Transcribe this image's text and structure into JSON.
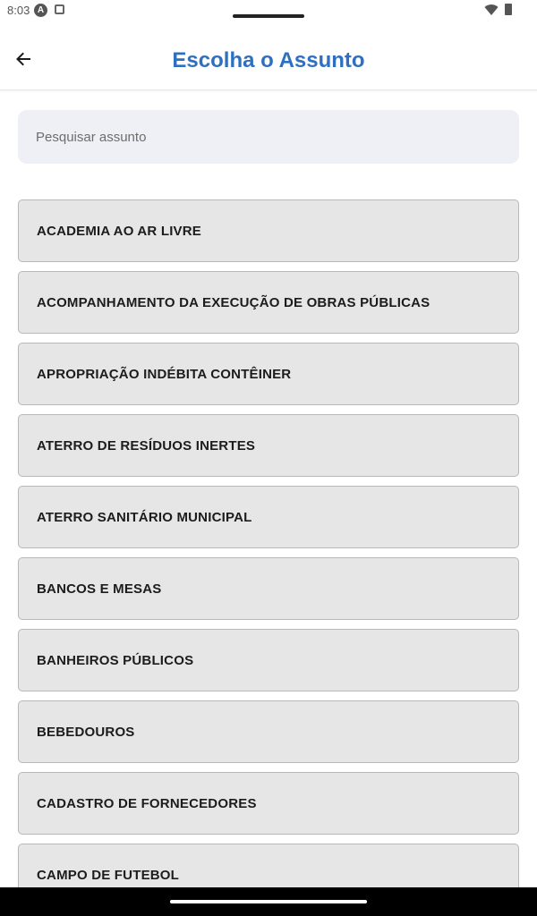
{
  "status_bar": {
    "time": "8:03",
    "app_icon_letter": "A"
  },
  "header": {
    "title": "Escolha o Assunto",
    "title_color": "#2f6fc0"
  },
  "search": {
    "placeholder": "Pesquisar assunto",
    "value": ""
  },
  "subjects": [
    {
      "label": "ACADEMIA AO AR LIVRE"
    },
    {
      "label": "ACOMPANHAMENTO DA EXECUÇÃO DE OBRAS PÚBLICAS"
    },
    {
      "label": "APROPRIAÇÃO INDÉBITA CONTÊINER"
    },
    {
      "label": "ATERRO DE RESÍDUOS INERTES"
    },
    {
      "label": "ATERRO SANITÁRIO MUNICIPAL"
    },
    {
      "label": "BANCOS E MESAS"
    },
    {
      "label": "BANHEIROS PÚBLICOS"
    },
    {
      "label": "BEBEDOUROS"
    },
    {
      "label": "CADASTRO DE FORNECEDORES"
    },
    {
      "label": "CAMPO DE FUTEBOL"
    }
  ],
  "icons": {
    "back": "arrow-left-icon",
    "wifi": "wifi-icon",
    "battery": "battery-icon",
    "app": "app-a-icon",
    "notification": "square-notification-icon"
  }
}
